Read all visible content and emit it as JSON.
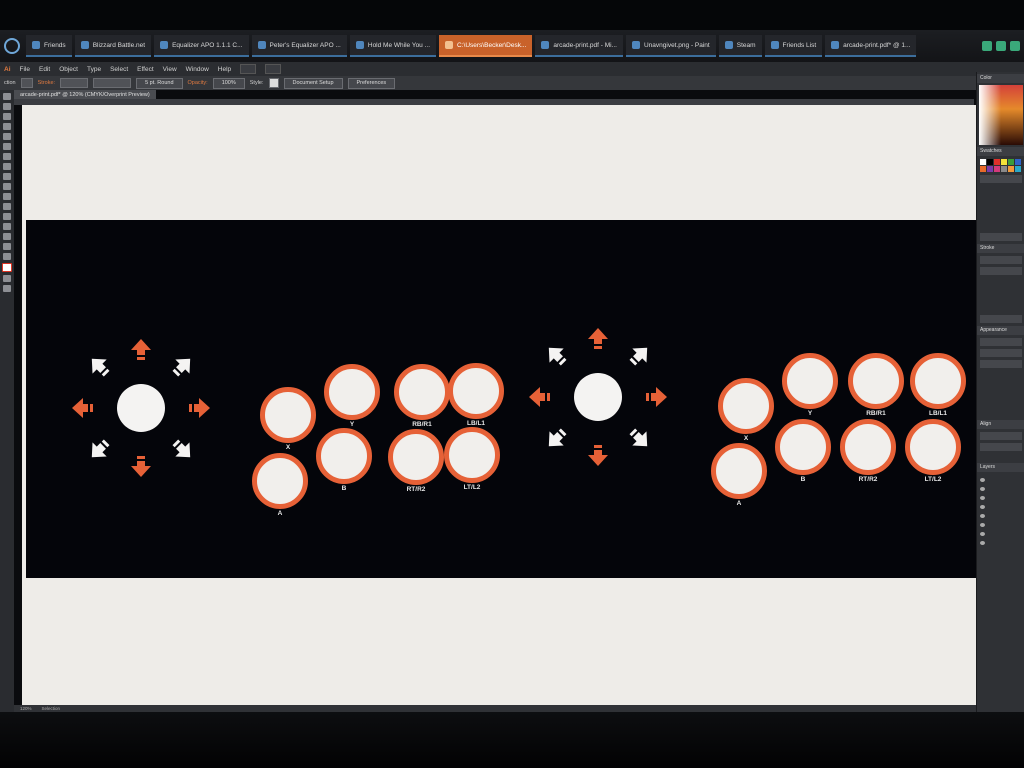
{
  "taskbar": {
    "tasks": [
      {
        "label": "Friends",
        "active": false
      },
      {
        "label": "Blizzard Battle.net",
        "active": false
      },
      {
        "label": "Equalizer APO 1.1.1 C...",
        "active": false
      },
      {
        "label": "Peter's Equalizer APO ...",
        "active": false
      },
      {
        "label": "Hold Me While You ...",
        "active": false
      },
      {
        "label": "C:\\Users\\Becker\\Desk...",
        "active": true
      },
      {
        "label": "arcade-print.pdf - Mi...",
        "active": false
      },
      {
        "label": "Unavngivet.png - Paint",
        "active": false
      },
      {
        "label": "Steam",
        "active": false
      },
      {
        "label": "Friends List",
        "active": false
      },
      {
        "label": "arcade-print.pdf* @ 1...",
        "active": false
      }
    ]
  },
  "menubar": [
    "File",
    "Edit",
    "Object",
    "Type",
    "Select",
    "Effect",
    "View",
    "Window",
    "Help"
  ],
  "controlbar": {
    "stroke_label": "Stroke:",
    "stroke_style": "5 pt. Round",
    "opacity_label": "Opacity:",
    "opacity_value": "100%",
    "style_label": "Style:",
    "document_setup": "Document Setup",
    "preferences": "Preferences"
  },
  "document_tab": "arcade-print.pdf* @ 120% (CMYK/Overprint Preview)",
  "panels": {
    "color": "Color",
    "swatches": "Swatches",
    "stroke": "Stroke",
    "appearance": "Appearance",
    "align": "Align",
    "layers": "Layers"
  },
  "statusbar": {
    "zoom": "120%",
    "tool": "Selection"
  },
  "layouts": [
    {
      "buttons": [
        {
          "label": "X"
        },
        {
          "label": "Y"
        },
        {
          "label": "RB/R1"
        },
        {
          "label": "LB/L1"
        },
        {
          "label": "A"
        },
        {
          "label": "B"
        },
        {
          "label": "RT/R2"
        },
        {
          "label": "LT/L2"
        }
      ]
    },
    {
      "buttons": [
        {
          "label": "X"
        },
        {
          "label": "Y"
        },
        {
          "label": "RB/R1"
        },
        {
          "label": "LB/L1"
        },
        {
          "label": "A"
        },
        {
          "label": "B"
        },
        {
          "label": "RT/R2"
        },
        {
          "label": "LT/L2"
        }
      ]
    }
  ],
  "colors": {
    "accent": "#e66137",
    "button_fill": "#f1efec",
    "artboard": "#04050a",
    "canvas": "#eeece8"
  }
}
